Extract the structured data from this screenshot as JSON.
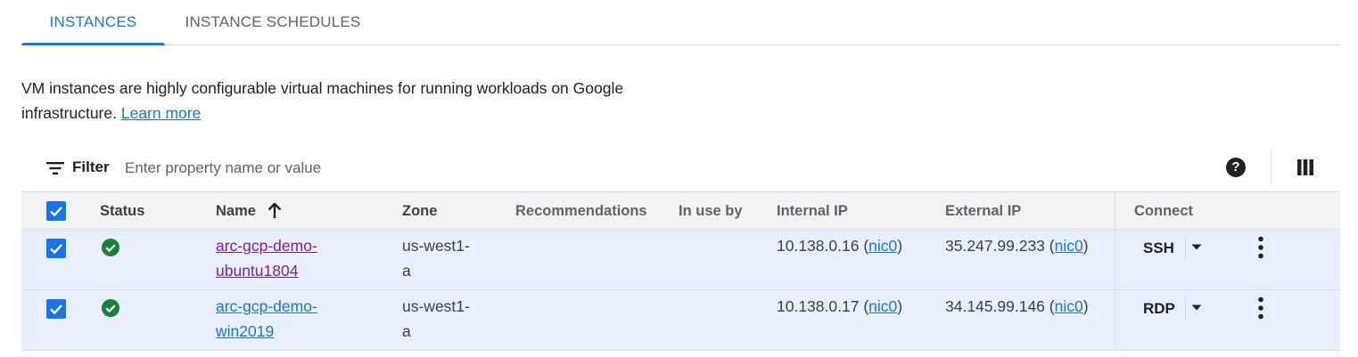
{
  "tabs": [
    {
      "label": "INSTANCES",
      "active": true
    },
    {
      "label": "INSTANCE SCHEDULES",
      "active": false
    }
  ],
  "description": {
    "text": "VM instances are highly configurable virtual machines for running workloads on Google infrastructure.",
    "link": "Learn more"
  },
  "filter": {
    "label": "Filter",
    "placeholder": "Enter property name or value",
    "icon": "filter-list-icon",
    "help_icon": "help-icon",
    "columns_icon": "column-display-icon"
  },
  "table": {
    "headers": {
      "status": "Status",
      "name": "Name",
      "zone": "Zone",
      "recommendations": "Recommendations",
      "in_use_by": "In use by",
      "internal_ip": "Internal IP",
      "external_ip": "External IP",
      "connect": "Connect"
    },
    "sort_icon": "arrow-upward-icon",
    "rows": [
      {
        "selected": true,
        "status": "running",
        "name_line1": "arc-gcp-demo-",
        "name_line2": "ubuntu1804",
        "zone_line1": "us-west1-",
        "zone_line2": "a",
        "recommendations": "",
        "in_use_by": "",
        "internal_ip": "10.138.0.16",
        "internal_nic": "nic0",
        "external_ip": "35.247.99.233",
        "external_nic": "nic0",
        "connect": "SSH"
      },
      {
        "selected": true,
        "status": "running",
        "name_line1": "arc-gcp-demo-",
        "name_line2": "win2019",
        "zone_line1": "us-west1-",
        "zone_line2": "a",
        "recommendations": "",
        "in_use_by": "",
        "internal_ip": "10.138.0.17",
        "internal_nic": "nic0",
        "external_ip": "34.145.99.146",
        "external_nic": "nic0",
        "connect": "RDP"
      }
    ]
  },
  "colors": {
    "accent": "#1a73e8",
    "status_ok": "#188038",
    "selected_row": "#e8f0fe",
    "visited_link": "#7b1fa2"
  }
}
